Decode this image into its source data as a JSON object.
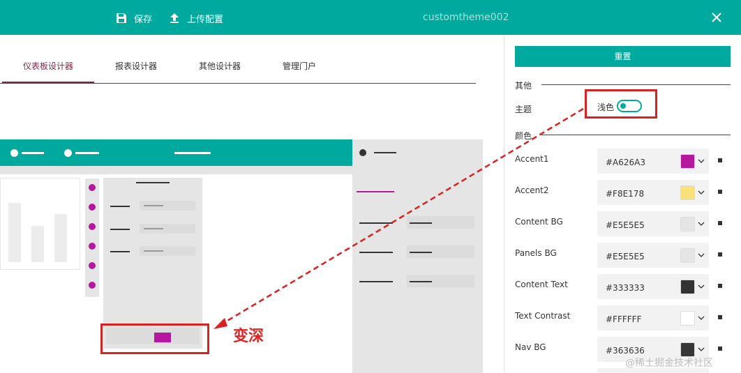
{
  "topbar": {
    "save_label": "保存",
    "upload_label": "上传配置",
    "title": "customtheme002",
    "save_icon": "save-icon",
    "upload_icon": "upload-icon",
    "close_icon": "close-icon"
  },
  "tabs": [
    {
      "label": "仪表板设计器",
      "active": true
    },
    {
      "label": "报表设计器",
      "active": false
    },
    {
      "label": "其他设计器",
      "active": false
    },
    {
      "label": "管理门户",
      "active": false
    }
  ],
  "annotation": {
    "text": "变深",
    "color": "#e02424"
  },
  "settings": {
    "reset_label": "重置",
    "other_section": "其他",
    "theme_label": "主题",
    "theme_value": "浅色",
    "theme_dark": false,
    "colors_section": "颜色",
    "colors": [
      {
        "name": "Accent1",
        "hex": "#A626A3",
        "swatch": "#b5179e"
      },
      {
        "name": "Accent2",
        "hex": "#F8E178",
        "swatch": "#f8e178"
      },
      {
        "name": "Content BG",
        "hex": "#E5E5E5",
        "swatch": "#e5e5e5"
      },
      {
        "name": "Panels BG",
        "hex": "#E5E5E5",
        "swatch": "#e5e5e5"
      },
      {
        "name": "Content Text",
        "hex": "#333333",
        "swatch": "#333333"
      },
      {
        "name": "Text Contrast",
        "hex": "#FFFFFF",
        "swatch": "#ffffff"
      },
      {
        "name": "Nav BG",
        "hex": "#363636",
        "swatch": "#363636"
      }
    ]
  },
  "theme_colors": {
    "primary": "#00a99d",
    "accent": "#b5179e",
    "tab_active": "#7a2b4a"
  },
  "watermark": "@稀土掘金技术社区"
}
